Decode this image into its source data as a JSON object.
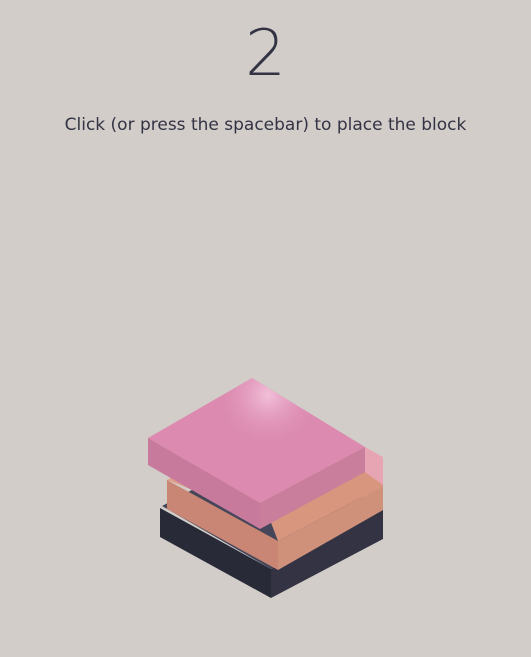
{
  "game": {
    "score": "2",
    "instructions": "Click (or press the spacebar) to place the block"
  },
  "colors": {
    "background": "#d2cdc9",
    "text": "#333344",
    "base_block": "#333344",
    "placed_block": "#d9967f",
    "moving_block": "#dc8aaf"
  }
}
